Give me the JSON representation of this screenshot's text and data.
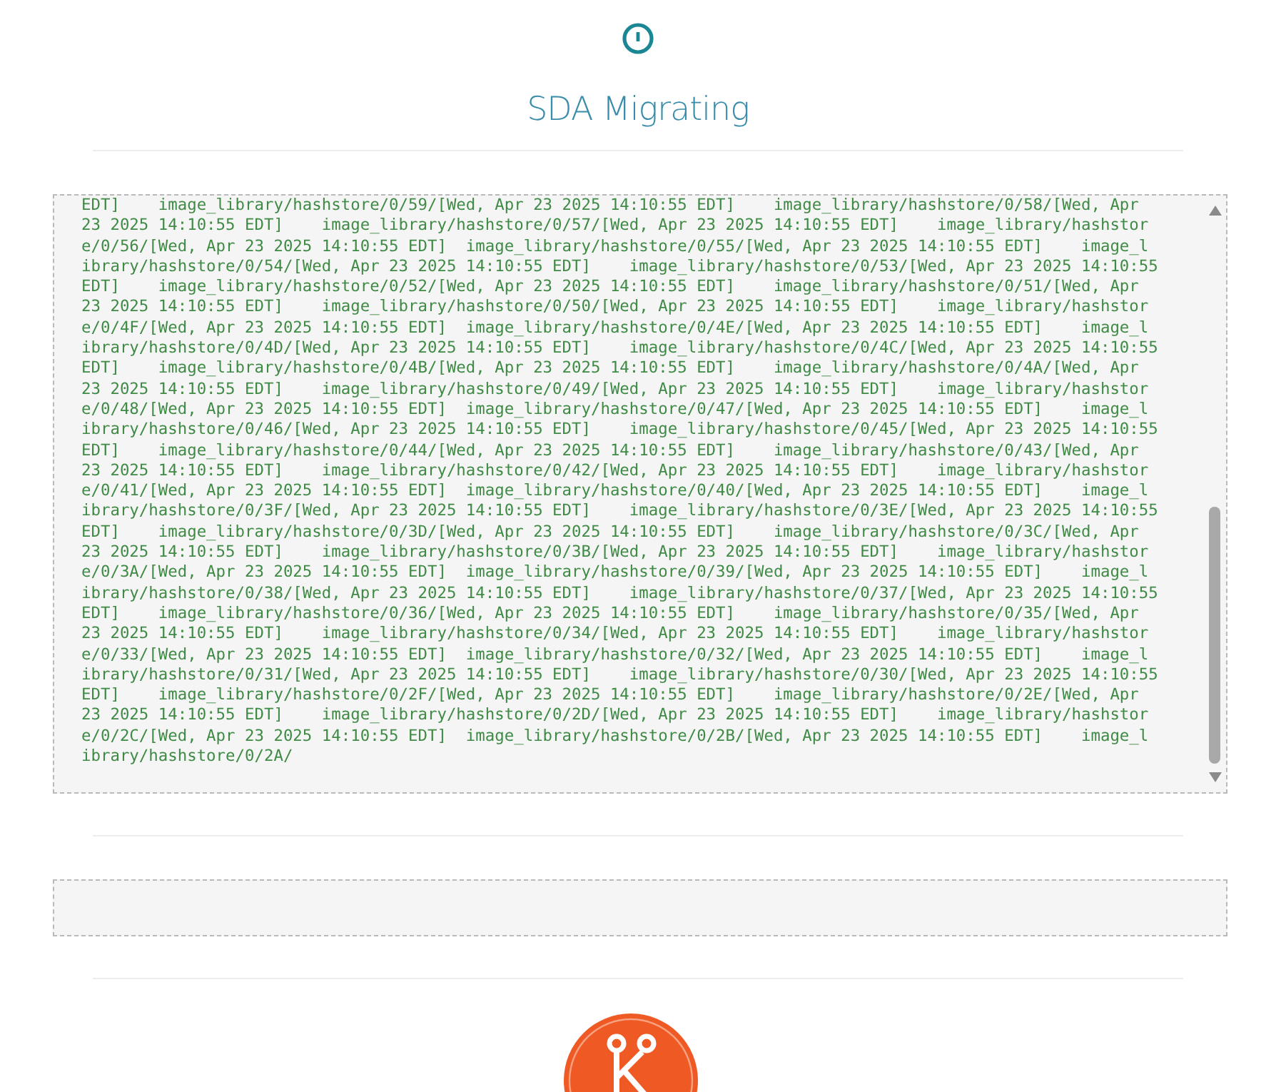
{
  "header": {
    "title": "SDA Migrating"
  },
  "log": {
    "lines": [
      "EDT]    image_library/hashstore/0/59/[Wed, Apr 23 2025 14:10:55 EDT]    image_library/hashstore/0/58/[Wed, Apr",
      "23 2025 14:10:55 EDT]    image_library/hashstore/0/57/[Wed, Apr 23 2025 14:10:55 EDT]    image_library/hashstor",
      "e/0/56/[Wed, Apr 23 2025 14:10:55 EDT]  image_library/hashstore/0/55/[Wed, Apr 23 2025 14:10:55 EDT]    image_l",
      "ibrary/hashstore/0/54/[Wed, Apr 23 2025 14:10:55 EDT]    image_library/hashstore/0/53/[Wed, Apr 23 2025 14:10:55",
      "EDT]    image_library/hashstore/0/52/[Wed, Apr 23 2025 14:10:55 EDT]    image_library/hashstore/0/51/[Wed, Apr",
      "23 2025 14:10:55 EDT]    image_library/hashstore/0/50/[Wed, Apr 23 2025 14:10:55 EDT]    image_library/hashstor",
      "e/0/4F/[Wed, Apr 23 2025 14:10:55 EDT]  image_library/hashstore/0/4E/[Wed, Apr 23 2025 14:10:55 EDT]    image_l",
      "ibrary/hashstore/0/4D/[Wed, Apr 23 2025 14:10:55 EDT]    image_library/hashstore/0/4C/[Wed, Apr 23 2025 14:10:55",
      "EDT]    image_library/hashstore/0/4B/[Wed, Apr 23 2025 14:10:55 EDT]    image_library/hashstore/0/4A/[Wed, Apr",
      "23 2025 14:10:55 EDT]    image_library/hashstore/0/49/[Wed, Apr 23 2025 14:10:55 EDT]    image_library/hashstor",
      "e/0/48/[Wed, Apr 23 2025 14:10:55 EDT]  image_library/hashstore/0/47/[Wed, Apr 23 2025 14:10:55 EDT]    image_l",
      "ibrary/hashstore/0/46/[Wed, Apr 23 2025 14:10:55 EDT]    image_library/hashstore/0/45/[Wed, Apr 23 2025 14:10:55",
      "EDT]    image_library/hashstore/0/44/[Wed, Apr 23 2025 14:10:55 EDT]    image_library/hashstore/0/43/[Wed, Apr",
      "23 2025 14:10:55 EDT]    image_library/hashstore/0/42/[Wed, Apr 23 2025 14:10:55 EDT]    image_library/hashstor",
      "e/0/41/[Wed, Apr 23 2025 14:10:55 EDT]  image_library/hashstore/0/40/[Wed, Apr 23 2025 14:10:55 EDT]    image_l",
      "ibrary/hashstore/0/3F/[Wed, Apr 23 2025 14:10:55 EDT]    image_library/hashstore/0/3E/[Wed, Apr 23 2025 14:10:55",
      "EDT]    image_library/hashstore/0/3D/[Wed, Apr 23 2025 14:10:55 EDT]    image_library/hashstore/0/3C/[Wed, Apr",
      "23 2025 14:10:55 EDT]    image_library/hashstore/0/3B/[Wed, Apr 23 2025 14:10:55 EDT]    image_library/hashstor",
      "e/0/3A/[Wed, Apr 23 2025 14:10:55 EDT]  image_library/hashstore/0/39/[Wed, Apr 23 2025 14:10:55 EDT]    image_l",
      "ibrary/hashstore/0/38/[Wed, Apr 23 2025 14:10:55 EDT]    image_library/hashstore/0/37/[Wed, Apr 23 2025 14:10:55",
      "EDT]    image_library/hashstore/0/36/[Wed, Apr 23 2025 14:10:55 EDT]    image_library/hashstore/0/35/[Wed, Apr",
      "23 2025 14:10:55 EDT]    image_library/hashstore/0/34/[Wed, Apr 23 2025 14:10:55 EDT]    image_library/hashstor",
      "e/0/33/[Wed, Apr 23 2025 14:10:55 EDT]  image_library/hashstore/0/32/[Wed, Apr 23 2025 14:10:55 EDT]    image_l",
      "ibrary/hashstore/0/31/[Wed, Apr 23 2025 14:10:55 EDT]    image_library/hashstore/0/30/[Wed, Apr 23 2025 14:10:55",
      "EDT]    image_library/hashstore/0/2F/[Wed, Apr 23 2025 14:10:55 EDT]    image_library/hashstore/0/2E/[Wed, Apr",
      "23 2025 14:10:55 EDT]    image_library/hashstore/0/2D/[Wed, Apr 23 2025 14:10:55 EDT]    image_library/hashstor",
      "e/0/2C/[Wed, Apr 23 2025 14:10:55 EDT]  image_library/hashstore/0/2B/[Wed, Apr 23 2025 14:10:55 EDT]    image_l",
      "ibrary/hashstore/0/2A/"
    ]
  }
}
